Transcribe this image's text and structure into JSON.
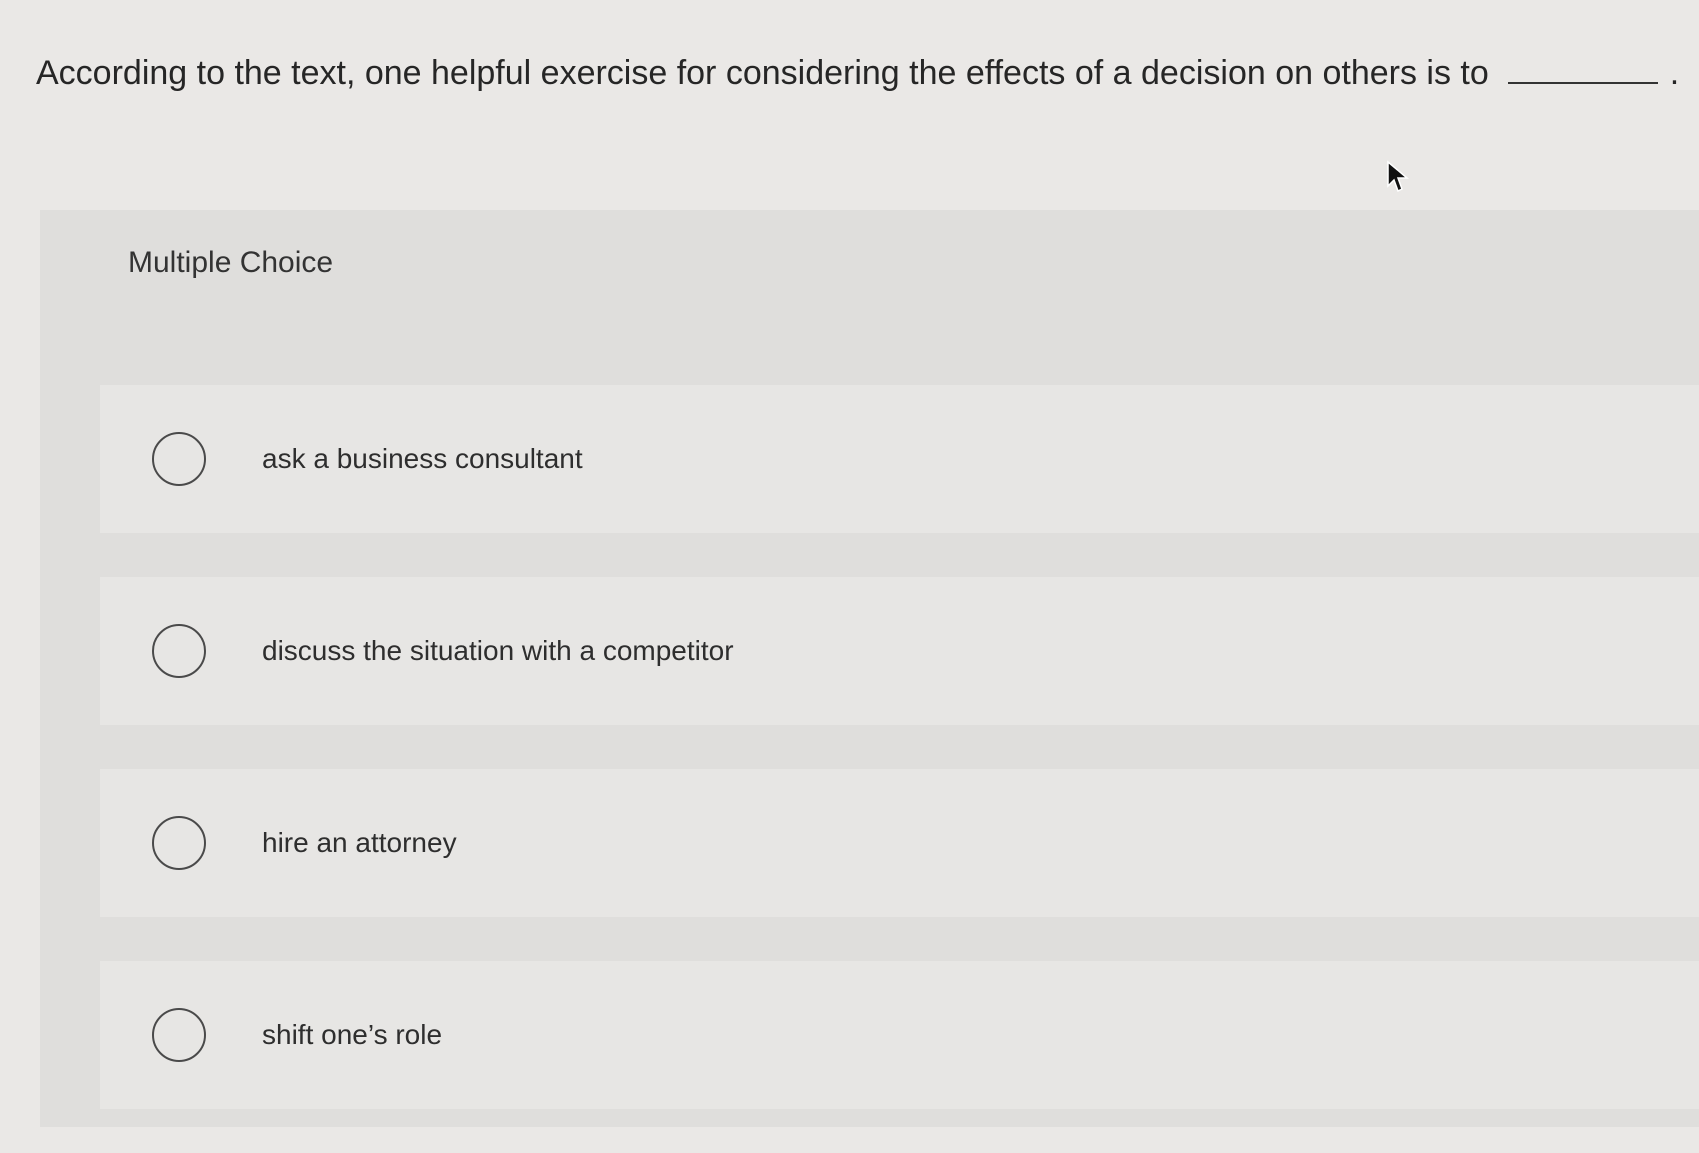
{
  "question": {
    "text": "According to the text, one helpful exercise for considering the effects of a decision on others is to",
    "trailing": "."
  },
  "panel": {
    "header": "Multiple Choice"
  },
  "options": [
    {
      "label": "ask a business consultant",
      "selected": false
    },
    {
      "label": "discuss the situation with a competitor",
      "selected": false
    },
    {
      "label": "hire an attorney",
      "selected": false
    },
    {
      "label": "shift one’s role",
      "selected": false
    }
  ],
  "colors": {
    "background": "#eae8e6",
    "panel": "#dfdedc",
    "option_row": "#e7e6e4",
    "text": "#2b2b2b"
  },
  "icons": {
    "cursor": "mouse-pointer-icon",
    "radio": "radio-unchecked-icon"
  }
}
